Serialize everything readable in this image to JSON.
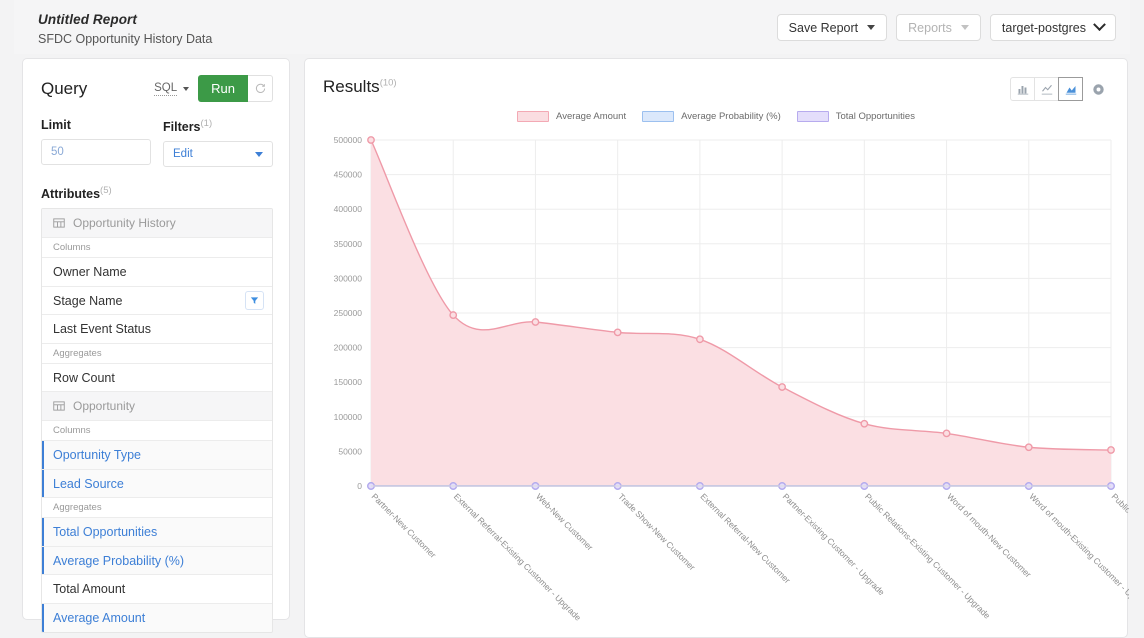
{
  "header": {
    "report_title": "Untitled Report",
    "report_subtitle": "SFDC Opportunity History Data",
    "save_report_label": "Save Report",
    "reports_label": "Reports",
    "datasource_label": "target-postgres"
  },
  "query": {
    "title": "Query",
    "sql_label": "SQL",
    "run_label": "Run",
    "refresh_icon": "refresh-icon",
    "limit_label": "Limit",
    "limit_placeholder": "50",
    "filters_label": "Filters",
    "filters_count": "(1)",
    "filters_value": "Edit",
    "attributes_label": "Attributes",
    "attributes_count": "(5)",
    "groups": [
      {
        "table": "Opportunity History",
        "sections": [
          {
            "label": "Columns",
            "items": [
              {
                "label": "Owner Name",
                "selected": false,
                "filter": false
              },
              {
                "label": "Stage Name",
                "selected": false,
                "filter": true
              },
              {
                "label": "Last Event Status",
                "selected": false,
                "filter": false
              }
            ]
          },
          {
            "label": "Aggregates",
            "items": [
              {
                "label": "Row Count",
                "selected": false,
                "filter": false
              }
            ]
          }
        ]
      },
      {
        "table": "Opportunity",
        "sections": [
          {
            "label": "Columns",
            "items": [
              {
                "label": "Oportunity Type",
                "selected": true,
                "filter": false
              },
              {
                "label": "Lead Source",
                "selected": true,
                "filter": false
              }
            ]
          },
          {
            "label": "Aggregates",
            "items": [
              {
                "label": "Total Opportunities",
                "selected": true,
                "filter": false
              },
              {
                "label": "Average Probability (%)",
                "selected": true,
                "filter": false
              },
              {
                "label": "Total Amount",
                "selected": false,
                "filter": false
              },
              {
                "label": "Average Amount",
                "selected": true,
                "filter": false
              }
            ]
          }
        ]
      }
    ]
  },
  "results": {
    "title": "Results",
    "count": "(10)",
    "tools": [
      {
        "name": "bar-chart-icon",
        "active": false
      },
      {
        "name": "line-chart-icon",
        "active": false
      },
      {
        "name": "area-chart-icon",
        "active": true
      },
      {
        "name": "chart-settings-icon",
        "active": false
      }
    ]
  },
  "chart_data": {
    "type": "area",
    "title": "",
    "xlabel": "",
    "ylabel": "",
    "ylim": [
      0,
      500000
    ],
    "yticks": [
      0,
      50000,
      100000,
      150000,
      200000,
      250000,
      300000,
      350000,
      400000,
      450000,
      500000
    ],
    "grid": true,
    "legend_position": "top",
    "interpolation": "spline",
    "categories": [
      "Partner-New Customer",
      "External Referral-Existing Customer - Upgrade",
      "Web-New Customer",
      "Trade Show-New Customer",
      "External Referral-New Customer",
      "Partner-Existing Customer - Upgrade",
      "Public Relations-Existing Customer - Upgrade",
      "Word of mouth-New Customer",
      "Word of mouth-Existing Customer - Upgrade",
      "Public Relations-New Customer"
    ],
    "series": [
      {
        "name": "Average Amount",
        "color": "#ef9aa8",
        "fill": "#fbdfe3",
        "values": [
          500000,
          247000,
          237000,
          222000,
          212000,
          143000,
          90000,
          76000,
          56000,
          52000
        ]
      },
      {
        "name": "Average Probability (%)",
        "color": "#7ba7e8",
        "fill": "#dbe8fb",
        "values": [
          58,
          40,
          45,
          52,
          47,
          50,
          44,
          46,
          42,
          48
        ]
      },
      {
        "name": "Total Opportunities",
        "color": "#b7abee",
        "fill": "#e4deFB",
        "values": [
          3,
          5,
          6,
          4,
          7,
          5,
          6,
          4,
          5,
          6
        ]
      }
    ]
  }
}
